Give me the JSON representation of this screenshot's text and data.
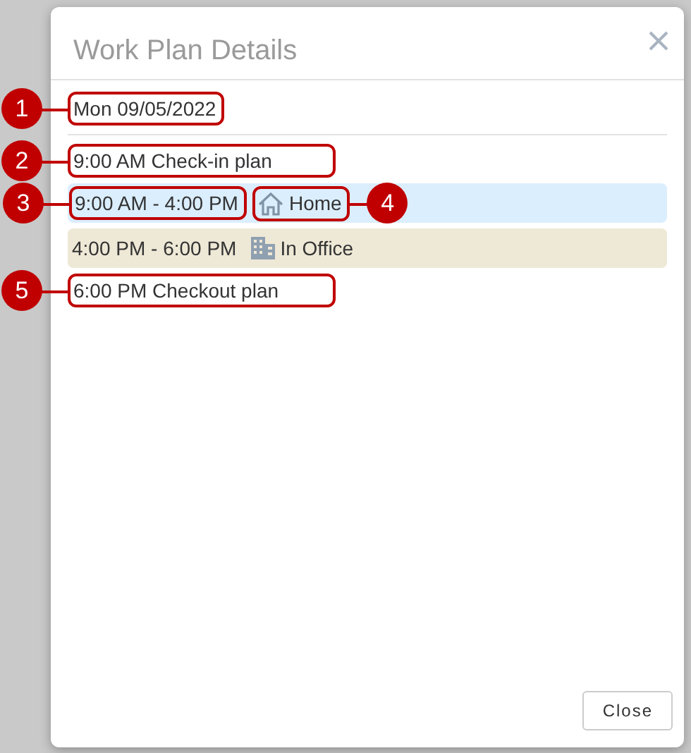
{
  "dialog": {
    "title": "Work Plan Details",
    "date": {
      "text": "Mon 09/05/2022",
      "callout": "1"
    },
    "entries": [
      {
        "kind": "plan",
        "text": "9:00 AM Check-in plan",
        "callout": "2"
      },
      {
        "kind": "segment",
        "time": "9:00 AM - 4:00 PM",
        "time_callout": "3",
        "location": {
          "kind": "home",
          "label": "Home",
          "callout": "4"
        },
        "color": "#dbeefe"
      },
      {
        "kind": "segment",
        "time": "4:00 PM - 6:00 PM",
        "location": {
          "kind": "office",
          "label": "In Office"
        },
        "color": "#eee8d6"
      },
      {
        "kind": "plan",
        "text": "6:00 PM Checkout plan",
        "callout": "5"
      }
    ],
    "close_button": "Close"
  }
}
